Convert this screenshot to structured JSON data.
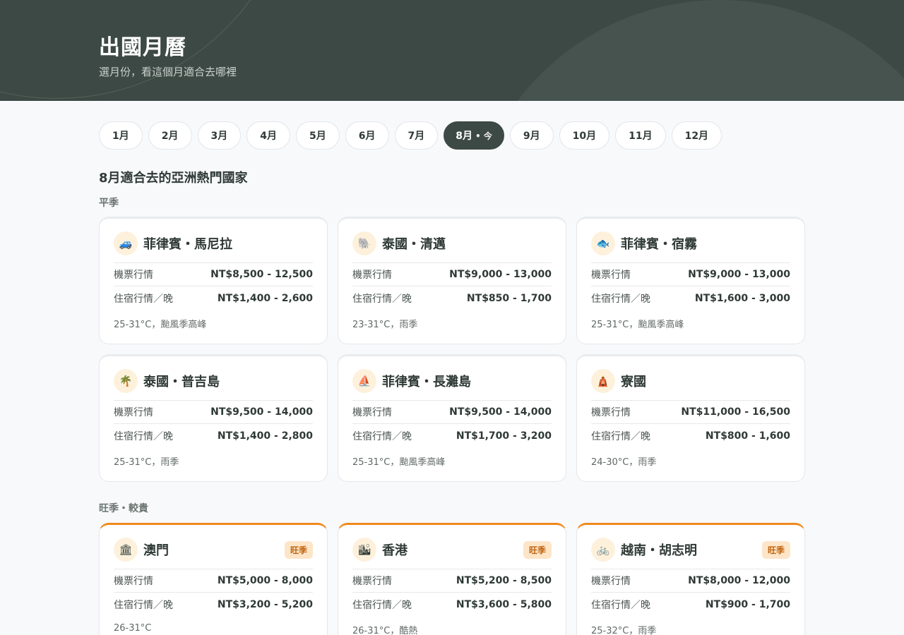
{
  "header": {
    "title": "出國月曆",
    "subtitle": "選月份，看這個月適合去哪裡"
  },
  "months": [
    {
      "label": "1月"
    },
    {
      "label": "2月"
    },
    {
      "label": "3月"
    },
    {
      "label": "4月"
    },
    {
      "label": "5月"
    },
    {
      "label": "6月"
    },
    {
      "label": "7月"
    },
    {
      "label": "8月",
      "today": "• 今"
    },
    {
      "label": "9月"
    },
    {
      "label": "10月"
    },
    {
      "label": "11月"
    },
    {
      "label": "12月"
    }
  ],
  "active_month": "8月",
  "section_title": "8月適合去的亞洲熱門國家",
  "groups": [
    {
      "label": "平季",
      "peak": false,
      "cards": [
        {
          "icon": "jeepney-icon",
          "glyph": "🚙",
          "name": "菲律賓・馬尼拉",
          "flight_label": "機票行情",
          "flight": "NT$8,500 - 12,500",
          "hotel_label": "住宿行情／晚",
          "hotel": "NT$1,400 - 2,600",
          "note": "25-31°C，颱風季高峰"
        },
        {
          "icon": "elephant-icon",
          "glyph": "🐘",
          "name": "泰國・清邁",
          "flight_label": "機票行情",
          "flight": "NT$9,000 - 13,000",
          "hotel_label": "住宿行情／晚",
          "hotel": "NT$850 - 1,700",
          "note": "23-31°C，雨季"
        },
        {
          "icon": "whale-shark-icon",
          "glyph": "🐟",
          "name": "菲律賓・宿霧",
          "flight_label": "機票行情",
          "flight": "NT$9,000 - 13,000",
          "hotel_label": "住宿行情／晚",
          "hotel": "NT$1,600 - 3,000",
          "note": "25-31°C，颱風季高峰"
        },
        {
          "icon": "palm-tree-icon",
          "glyph": "🌴",
          "name": "泰國・普吉島",
          "flight_label": "機票行情",
          "flight": "NT$9,500 - 14,000",
          "hotel_label": "住宿行情／晚",
          "hotel": "NT$1,400 - 2,800",
          "note": "25-31°C，雨季"
        },
        {
          "icon": "sailboat-icon",
          "glyph": "⛵",
          "name": "菲律賓・長灘島",
          "flight_label": "機票行情",
          "flight": "NT$9,500 - 14,000",
          "hotel_label": "住宿行情／晚",
          "hotel": "NT$1,700 - 3,200",
          "note": "25-31°C，颱風季高峰"
        },
        {
          "icon": "temple-icon",
          "glyph": "🛕",
          "name": "寮國",
          "flight_label": "機票行情",
          "flight": "NT$11,000 - 16,500",
          "hotel_label": "住宿行情／晚",
          "hotel": "NT$800 - 1,600",
          "note": "24-30°C，雨季"
        }
      ]
    },
    {
      "label": "旺季・較貴",
      "peak": true,
      "cards": [
        {
          "icon": "casino-tower-icon",
          "glyph": "🏛",
          "name": "澳門",
          "badge": "旺季",
          "flight_label": "機票行情",
          "flight": "NT$5,000 - 8,000",
          "hotel_label": "住宿行情／晚",
          "hotel": "NT$3,200 - 5,200",
          "note": "26-31°C"
        },
        {
          "icon": "skyline-icon",
          "glyph": "🏙",
          "name": "香港",
          "badge": "旺季",
          "flight_label": "機票行情",
          "flight": "NT$5,200 - 8,500",
          "hotel_label": "住宿行情／晚",
          "hotel": "NT$3,600 - 5,800",
          "note": "26-31°C，酷熱"
        },
        {
          "icon": "bicycle-icon",
          "glyph": "🚲",
          "name": "越南・胡志明",
          "badge": "旺季",
          "flight_label": "機票行情",
          "flight": "NT$8,000 - 12,000",
          "hotel_label": "住宿行情／晚",
          "hotel": "NT$900 - 1,700",
          "note": "25-32°C，雨季"
        }
      ]
    }
  ]
}
